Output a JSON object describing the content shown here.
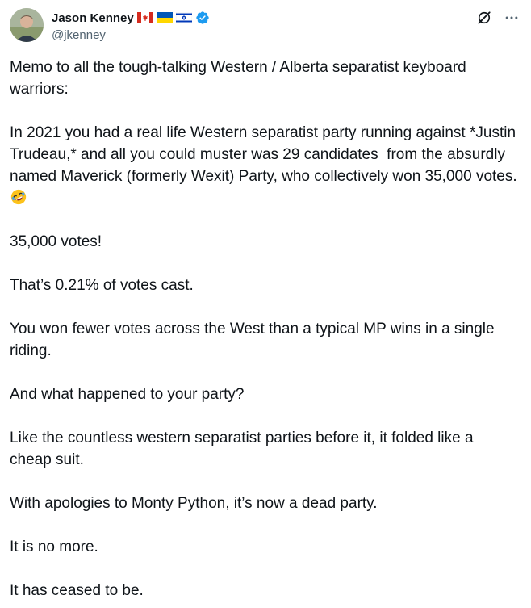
{
  "author": {
    "name": "Jason Kenney",
    "handle": "@jkenney",
    "flags": [
      "canada-flag-icon",
      "ukraine-flag-icon",
      "israel-flag-icon"
    ],
    "verified_color": "#1d9bf0"
  },
  "actions": {
    "grok_icon": "grok-icon",
    "more_icon": "more-options-icon"
  },
  "tweet": {
    "p1": "Memo to all the tough-talking Western / Alberta separatist keyboard warriors:",
    "p2": "In 2021 you had a real life Western separatist party running against *Justin Trudeau,* and all you could muster was 29 candidates  from the absurdly named Maverick (formerly Wexit) Party, who collectively won 35,000 votes.",
    "p2_emoji": "rolling-on-floor-laughing-emoji",
    "p3": "35,000 votes!",
    "p4": "That’s 0.21% of votes cast.",
    "p5": "You won fewer votes across the West than a typical MP wins in a single riding.",
    "p6": "And what happened to your party?",
    "p7": "Like the countless western separatist parties before it, it folded like a cheap suit.",
    "p8": "With apologies to Monty Python, it’s now a dead party.",
    "p9": "It is no more.",
    "p10": "It has ceased to be."
  }
}
